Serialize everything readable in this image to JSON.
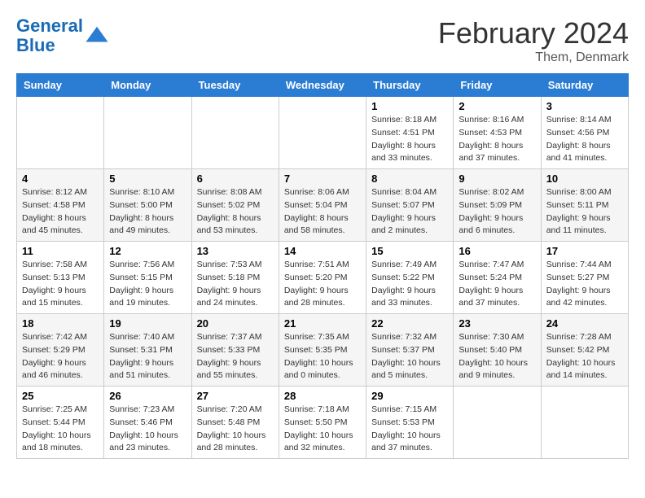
{
  "logo": {
    "line1": "General",
    "line2": "Blue"
  },
  "title": "February 2024",
  "location": "Them, Denmark",
  "days_of_week": [
    "Sunday",
    "Monday",
    "Tuesday",
    "Wednesday",
    "Thursday",
    "Friday",
    "Saturday"
  ],
  "weeks": [
    [
      {
        "day": "",
        "info": ""
      },
      {
        "day": "",
        "info": ""
      },
      {
        "day": "",
        "info": ""
      },
      {
        "day": "",
        "info": ""
      },
      {
        "day": "1",
        "info": "Sunrise: 8:18 AM\nSunset: 4:51 PM\nDaylight: 8 hours\nand 33 minutes."
      },
      {
        "day": "2",
        "info": "Sunrise: 8:16 AM\nSunset: 4:53 PM\nDaylight: 8 hours\nand 37 minutes."
      },
      {
        "day": "3",
        "info": "Sunrise: 8:14 AM\nSunset: 4:56 PM\nDaylight: 8 hours\nand 41 minutes."
      }
    ],
    [
      {
        "day": "4",
        "info": "Sunrise: 8:12 AM\nSunset: 4:58 PM\nDaylight: 8 hours\nand 45 minutes."
      },
      {
        "day": "5",
        "info": "Sunrise: 8:10 AM\nSunset: 5:00 PM\nDaylight: 8 hours\nand 49 minutes."
      },
      {
        "day": "6",
        "info": "Sunrise: 8:08 AM\nSunset: 5:02 PM\nDaylight: 8 hours\nand 53 minutes."
      },
      {
        "day": "7",
        "info": "Sunrise: 8:06 AM\nSunset: 5:04 PM\nDaylight: 8 hours\nand 58 minutes."
      },
      {
        "day": "8",
        "info": "Sunrise: 8:04 AM\nSunset: 5:07 PM\nDaylight: 9 hours\nand 2 minutes."
      },
      {
        "day": "9",
        "info": "Sunrise: 8:02 AM\nSunset: 5:09 PM\nDaylight: 9 hours\nand 6 minutes."
      },
      {
        "day": "10",
        "info": "Sunrise: 8:00 AM\nSunset: 5:11 PM\nDaylight: 9 hours\nand 11 minutes."
      }
    ],
    [
      {
        "day": "11",
        "info": "Sunrise: 7:58 AM\nSunset: 5:13 PM\nDaylight: 9 hours\nand 15 minutes."
      },
      {
        "day": "12",
        "info": "Sunrise: 7:56 AM\nSunset: 5:15 PM\nDaylight: 9 hours\nand 19 minutes."
      },
      {
        "day": "13",
        "info": "Sunrise: 7:53 AM\nSunset: 5:18 PM\nDaylight: 9 hours\nand 24 minutes."
      },
      {
        "day": "14",
        "info": "Sunrise: 7:51 AM\nSunset: 5:20 PM\nDaylight: 9 hours\nand 28 minutes."
      },
      {
        "day": "15",
        "info": "Sunrise: 7:49 AM\nSunset: 5:22 PM\nDaylight: 9 hours\nand 33 minutes."
      },
      {
        "day": "16",
        "info": "Sunrise: 7:47 AM\nSunset: 5:24 PM\nDaylight: 9 hours\nand 37 minutes."
      },
      {
        "day": "17",
        "info": "Sunrise: 7:44 AM\nSunset: 5:27 PM\nDaylight: 9 hours\nand 42 minutes."
      }
    ],
    [
      {
        "day": "18",
        "info": "Sunrise: 7:42 AM\nSunset: 5:29 PM\nDaylight: 9 hours\nand 46 minutes."
      },
      {
        "day": "19",
        "info": "Sunrise: 7:40 AM\nSunset: 5:31 PM\nDaylight: 9 hours\nand 51 minutes."
      },
      {
        "day": "20",
        "info": "Sunrise: 7:37 AM\nSunset: 5:33 PM\nDaylight: 9 hours\nand 55 minutes."
      },
      {
        "day": "21",
        "info": "Sunrise: 7:35 AM\nSunset: 5:35 PM\nDaylight: 10 hours\nand 0 minutes."
      },
      {
        "day": "22",
        "info": "Sunrise: 7:32 AM\nSunset: 5:37 PM\nDaylight: 10 hours\nand 5 minutes."
      },
      {
        "day": "23",
        "info": "Sunrise: 7:30 AM\nSunset: 5:40 PM\nDaylight: 10 hours\nand 9 minutes."
      },
      {
        "day": "24",
        "info": "Sunrise: 7:28 AM\nSunset: 5:42 PM\nDaylight: 10 hours\nand 14 minutes."
      }
    ],
    [
      {
        "day": "25",
        "info": "Sunrise: 7:25 AM\nSunset: 5:44 PM\nDaylight: 10 hours\nand 18 minutes."
      },
      {
        "day": "26",
        "info": "Sunrise: 7:23 AM\nSunset: 5:46 PM\nDaylight: 10 hours\nand 23 minutes."
      },
      {
        "day": "27",
        "info": "Sunrise: 7:20 AM\nSunset: 5:48 PM\nDaylight: 10 hours\nand 28 minutes."
      },
      {
        "day": "28",
        "info": "Sunrise: 7:18 AM\nSunset: 5:50 PM\nDaylight: 10 hours\nand 32 minutes."
      },
      {
        "day": "29",
        "info": "Sunrise: 7:15 AM\nSunset: 5:53 PM\nDaylight: 10 hours\nand 37 minutes."
      },
      {
        "day": "",
        "info": ""
      },
      {
        "day": "",
        "info": ""
      }
    ]
  ]
}
